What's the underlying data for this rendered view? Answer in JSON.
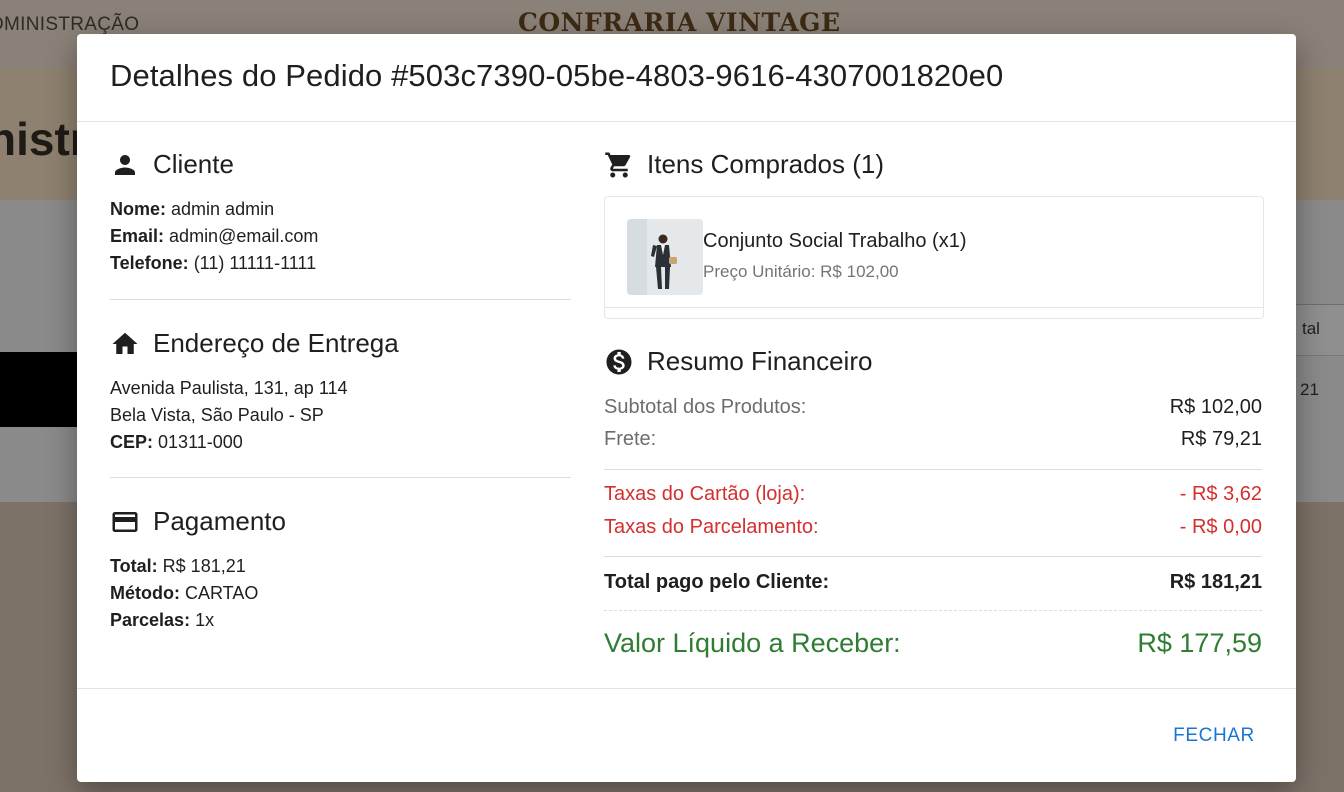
{
  "background": {
    "nav_item": "DMINISTRAÇÃO",
    "brand": "CONFRARIA VINTAGE",
    "page_title": "nistr",
    "table_header": "tal",
    "table_cell": "21"
  },
  "modal": {
    "title": "Detalhes do Pedido #503c7390-05be-4803-9616-4307001820e0",
    "close_label": "FECHAR"
  },
  "cliente": {
    "heading": "Cliente",
    "icon": "person-icon",
    "nome_label": "Nome:",
    "nome": "admin admin",
    "email_label": "Email:",
    "email": "admin@email.com",
    "telefone_label": "Telefone:",
    "telefone": "(11) 11111-1111"
  },
  "endereco": {
    "heading": "Endereço de Entrega",
    "icon": "home-icon",
    "linha1": "Avenida Paulista, 131, ap 114",
    "linha2": "Bela Vista, São Paulo - SP",
    "cep_label": "CEP:",
    "cep": "01311-000"
  },
  "pagamento": {
    "heading": "Pagamento",
    "icon": "credit-card-icon",
    "total_label": "Total:",
    "total": "R$ 181,21",
    "metodo_label": "Método:",
    "metodo": "CARTAO",
    "parcelas_label": "Parcelas:",
    "parcelas": "1x"
  },
  "itens": {
    "heading": "Itens Comprados (1)",
    "icon": "shopping-cart-icon",
    "list": [
      {
        "name": "Conjunto Social Trabalho (x1)",
        "price": "Preço Unitário: R$ 102,00"
      }
    ]
  },
  "resumo": {
    "heading": "Resumo Financeiro",
    "icon": "dollar-circle-icon",
    "subtotal_label": "Subtotal dos Produtos:",
    "subtotal": "R$ 102,00",
    "frete_label": "Frete:",
    "frete": "R$ 79,21",
    "taxa_cartao_label": "Taxas do Cartão (loja):",
    "taxa_cartao": "- R$ 3,62",
    "taxa_parcelamento_label": "Taxas do Parcelamento:",
    "taxa_parcelamento": "- R$ 0,00",
    "total_label": "Total pago pelo Cliente:",
    "total": "R$ 181,21",
    "liquido_label": "Valor Líquido a Receber:",
    "liquido": "R$ 177,59"
  },
  "colors": {
    "accent": "#1976d2",
    "negative": "#d32f2f",
    "positive": "#2e7d32"
  }
}
